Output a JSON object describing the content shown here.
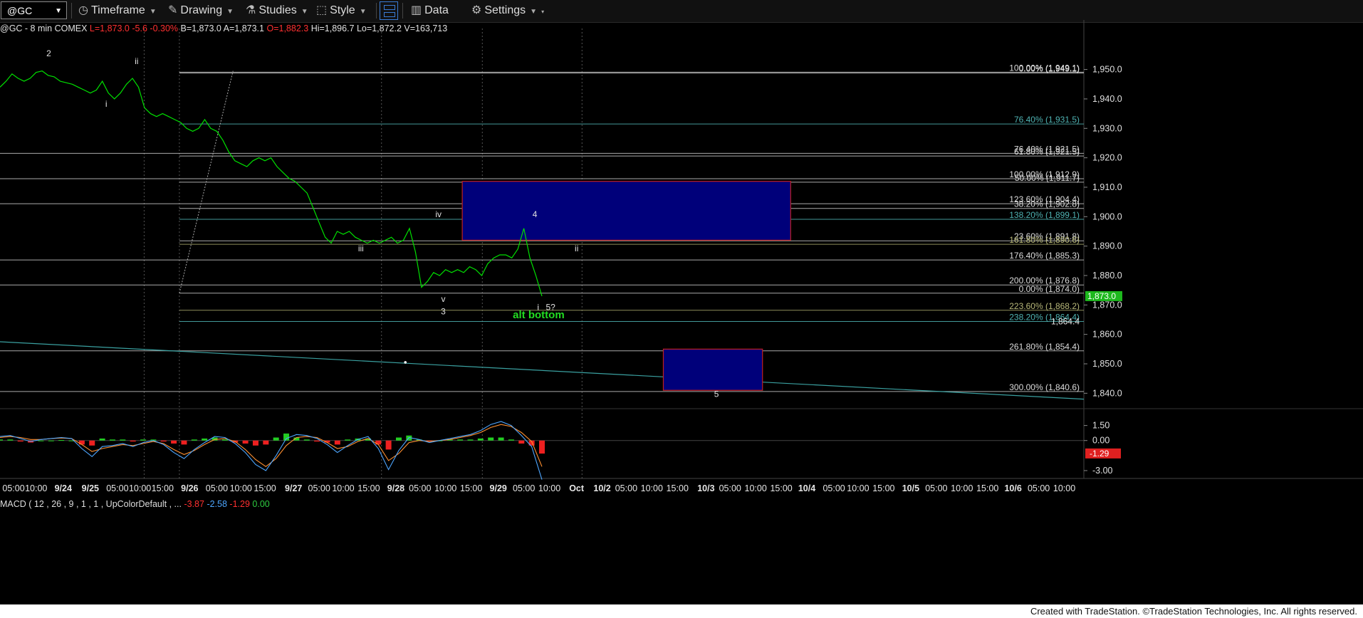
{
  "toolbar": {
    "symbol": "@GC",
    "items": [
      {
        "label": "Timeframe",
        "icon": "clock-icon"
      },
      {
        "label": "Drawing",
        "icon": "pencil-icon"
      },
      {
        "label": "Studies",
        "icon": "flask-icon"
      },
      {
        "label": "Style",
        "icon": "style-icon"
      },
      {
        "label": "Data",
        "icon": "bars-icon"
      },
      {
        "label": "Settings",
        "icon": "gear-icon"
      }
    ]
  },
  "info": {
    "title": "@GC - 8 min  COMEX",
    "last": "L=1,873.0",
    "chg": "-5.6",
    "pct": "-0.30%",
    "bid": "B=1,873.0",
    "ask": "A=1,873.1",
    "open": "O=1,882.3",
    "hi": "Hi=1,896.7",
    "lo": "Lo=1,872.2",
    "vol": "V=163,713"
  },
  "macd_info": {
    "label": "MACD ( 12 , 26 , 9 , 1 , 1 , UpColorDefault , ...",
    "v1": "-3.87",
    "v2": "-2.58",
    "v3": "-1.29",
    "v4": "0.00"
  },
  "footer": "Created with TradeStation. ©TradeStation Technologies, Inc. All rights reserved.",
  "colors": {
    "price_line": "#00e000",
    "fib_text": "#d8d8d8",
    "fib_teal": "#4fb3b3",
    "box_fill": "#00007a",
    "box_border": "#c02020",
    "trend_line": "#3aa0a0",
    "macd_line": "#4da6ff",
    "signal_line": "#ff9030",
    "hist_up": "#22cc22",
    "hist_down": "#ee2020"
  },
  "chart_data": {
    "type": "line",
    "title": "@GC - 8 min COMEX",
    "ylim": [
      1835,
      1962
    ],
    "y_ticks": [
      1840,
      1850,
      1860,
      1870,
      1880,
      1890,
      1900,
      1910,
      1920,
      1930,
      1940,
      1950
    ],
    "y_tick_labels": [
      "1,840.0",
      "1,850.0",
      "1,860.0",
      "1,870.0",
      "1,880.0",
      "1,890.0",
      "1,900.0",
      "1,910.0",
      "1,920.0",
      "1,930.0",
      "1,940.0",
      "1,950.0"
    ],
    "last_price": {
      "value": 1873.0,
      "label": "1,873.0"
    },
    "x_tick_labels": [
      "05:00",
      "10:00",
      "9/24",
      "9/25",
      "05:00",
      "10:00",
      "15:00",
      "9/26",
      "05:00",
      "10:00",
      "15:00",
      "9/27",
      "05:00",
      "10:00",
      "15:00",
      "9/28",
      "05:00",
      "10:00",
      "15:00",
      "9/29",
      "05:00",
      "10:00",
      "Oct",
      "10/2",
      "05:00",
      "10:00",
      "15:00",
      "10/3",
      "05:00",
      "10:00",
      "15:00",
      "10/4",
      "05:00",
      "10:00",
      "15:00",
      "10/5",
      "05:00",
      "10:00",
      "15:00",
      "10/6",
      "05:00",
      "10:00"
    ],
    "x_tick_bold": [
      "9/24",
      "9/25",
      "9/26",
      "9/27",
      "9/28",
      "9/29",
      "Oct",
      "10/2",
      "10/3",
      "10/4",
      "10/5",
      "10/6"
    ],
    "series": [
      {
        "name": "@GC",
        "values": [
          1944,
          1946,
          1948.5,
          1947,
          1946,
          1947,
          1949,
          1949.5,
          1948,
          1947.5,
          1946,
          1945.5,
          1945,
          1944,
          1943,
          1942,
          1943,
          1946,
          1942,
          1940,
          1942,
          1945,
          1947,
          1944,
          1937,
          1935,
          1934,
          1935,
          1934,
          1933,
          1932,
          1930,
          1929,
          1930,
          1933,
          1930,
          1929,
          1926,
          1922,
          1919,
          1918,
          1917,
          1919,
          1920,
          1919,
          1920,
          1917,
          1915,
          1913,
          1912,
          1910,
          1908,
          1903,
          1898,
          1893,
          1891,
          1895,
          1894,
          1895,
          1893,
          1892,
          1891,
          1892,
          1891,
          1892,
          1893,
          1891,
          1892,
          1896,
          1888,
          1876,
          1878,
          1881,
          1880,
          1882,
          1881,
          1882,
          1881,
          1883,
          1882,
          1880,
          1884,
          1886,
          1887,
          1887,
          1886,
          1889,
          1896,
          1886,
          1880,
          1873
        ]
      },
      {
        "name": "MACD",
        "values": [
          0.4,
          0.5,
          0.2,
          -0.1,
          0.1,
          0.2,
          0.3,
          0.2,
          -0.8,
          -1.6,
          -0.6,
          -0.5,
          -0.3,
          -0.6,
          -0.2,
          0.0,
          -0.4,
          -1.2,
          -1.8,
          -0.9,
          -0.2,
          0.4,
          0.3,
          -0.3,
          -1.2,
          -2.4,
          -3.0,
          -1.5,
          0.2,
          0.6,
          0.5,
          0.2,
          -0.4,
          -1.2,
          -0.5,
          0.1,
          0.4,
          -0.8,
          -2.9,
          -1.0,
          0.3,
          0.1,
          -0.2,
          0.0,
          0.2,
          0.4,
          0.6,
          1.0,
          1.6,
          1.9,
          1.5,
          0.5,
          -0.6,
          -3.9
        ]
      },
      {
        "name": "Signal",
        "values": [
          0.3,
          0.4,
          0.3,
          0.1,
          0.1,
          0.2,
          0.25,
          0.2,
          -0.4,
          -1.1,
          -0.8,
          -0.6,
          -0.4,
          -0.5,
          -0.3,
          -0.1,
          -0.3,
          -0.9,
          -1.4,
          -1.0,
          -0.4,
          0.1,
          0.2,
          -0.1,
          -0.9,
          -1.9,
          -2.6,
          -1.8,
          -0.5,
          0.3,
          0.4,
          0.3,
          -0.2,
          -0.8,
          -0.6,
          -0.1,
          0.2,
          -0.4,
          -2.0,
          -1.3,
          -0.2,
          0.0,
          -0.1,
          0.0,
          0.1,
          0.3,
          0.5,
          0.8,
          1.3,
          1.6,
          1.4,
          0.8,
          -0.1,
          -2.6
        ]
      },
      {
        "name": "Hist",
        "values": [
          0.1,
          0.1,
          -0.1,
          -0.2,
          0.0,
          0.0,
          0.05,
          0.0,
          -0.4,
          -0.5,
          0.2,
          0.1,
          0.1,
          -0.1,
          0.1,
          0.1,
          -0.1,
          -0.3,
          -0.4,
          0.1,
          0.2,
          0.3,
          0.1,
          -0.2,
          -0.3,
          -0.5,
          -0.4,
          0.3,
          0.7,
          0.3,
          0.1,
          -0.1,
          -0.2,
          -0.4,
          0.1,
          0.2,
          0.2,
          -0.4,
          -0.9,
          0.3,
          0.5,
          0.1,
          -0.1,
          0.0,
          0.1,
          0.1,
          0.1,
          0.2,
          0.3,
          0.3,
          0.1,
          -0.3,
          -0.5,
          -1.3
        ]
      }
    ],
    "macd_ylim": [
      -3.5,
      1.9
    ],
    "macd_ticks": [
      "1.50",
      "0.00",
      "-3.00"
    ],
    "macd_last": "-1.29",
    "fib_levels": [
      {
        "label": "100.00% (1,949.1)",
        "value": 1949.1,
        "color": "gray"
      },
      {
        "label": "0.00% (1,949.1)",
        "value": 1948.8,
        "color": "gray"
      },
      {
        "label": "76.40% (1,931.5)",
        "value": 1931.5,
        "color": "teal"
      },
      {
        "label": "76.40% (1,921.5)",
        "value": 1921.5,
        "color": "gray"
      },
      {
        "label": "61.80% (1,921.5)",
        "value": 1920.6,
        "color": "gray"
      },
      {
        "label": "100.00% (1,912.9)",
        "value": 1912.9,
        "color": "gray"
      },
      {
        "label": "50.00% (1,911.7)",
        "value": 1911.7,
        "color": "gray"
      },
      {
        "label": "123.60% (1,904.4)",
        "value": 1904.4,
        "color": "gray"
      },
      {
        "label": "38.20% (1,902.8)",
        "value": 1902.8,
        "color": "gray"
      },
      {
        "label": "138.20% (1,899.1)",
        "value": 1899.1,
        "color": "teal"
      },
      {
        "label": "23.60% (1,891.8)",
        "value": 1891.8,
        "color": "gray"
      },
      {
        "label": "161.80% (1,890.6)",
        "value": 1890.6,
        "color": "olive"
      },
      {
        "label": "176.40% (1,885.3)",
        "value": 1885.3,
        "color": "gray"
      },
      {
        "label": "200.00% (1,876.8)",
        "value": 1876.8,
        "color": "gray"
      },
      {
        "label": "0.00% (1,874.0)",
        "value": 1874.0,
        "color": "gray"
      },
      {
        "label": "223.60% (1,868.2)",
        "value": 1868.2,
        "color": "olive"
      },
      {
        "label": "238.20% (1,864.4)",
        "value": 1864.4,
        "color": "teal"
      },
      {
        "label": "261.80% (1,854.4)",
        "value": 1854.4,
        "color": "gray"
      },
      {
        "label": "300.00% (1,840.6)",
        "value": 1840.6,
        "color": "gray"
      }
    ],
    "extra_level": {
      "label": "1,864.4",
      "value": 1864.4
    },
    "target_boxes": [
      {
        "name": "upper-target-box",
        "y_top": 1912.0,
        "y_bottom": 1892.0,
        "x0": 0.4265,
        "x1": 0.7295
      },
      {
        "name": "lower-target-box",
        "y_top": 1855.0,
        "y_bottom": 1841.0,
        "x0": 0.612,
        "x1": 0.7035
      }
    ],
    "annotations": [
      {
        "text": "2",
        "x": 0.045,
        "y": 1954.5,
        "color": "white"
      },
      {
        "text": "ii",
        "x": 0.126,
        "y": 1951.8,
        "color": "white"
      },
      {
        "text": "i",
        "x": 0.098,
        "y": 1937.3,
        "color": "white"
      },
      {
        "text": "iii",
        "x": 0.333,
        "y": 1888.2,
        "color": "white"
      },
      {
        "text": "iv",
        "x": 0.4045,
        "y": 1899.8,
        "color": "white"
      },
      {
        "text": "4",
        "x": 0.4935,
        "y": 1899.8,
        "color": "white"
      },
      {
        "text": "ii",
        "x": 0.532,
        "y": 1888.2,
        "color": "white"
      },
      {
        "text": "v",
        "x": 0.409,
        "y": 1871.0,
        "color": "white"
      },
      {
        "text": "3",
        "x": 0.409,
        "y": 1866.8,
        "color": "white"
      },
      {
        "text": "i",
        "x": 0.4965,
        "y": 1868.3,
        "color": "white"
      },
      {
        "text": "5?",
        "x": 0.508,
        "y": 1868.3,
        "color": "white"
      },
      {
        "text": "alt bottom",
        "x": 0.497,
        "y": 1865.5,
        "color": "green"
      },
      {
        "text": "5",
        "x": 0.661,
        "y": 1838.7,
        "color": "white"
      }
    ]
  }
}
